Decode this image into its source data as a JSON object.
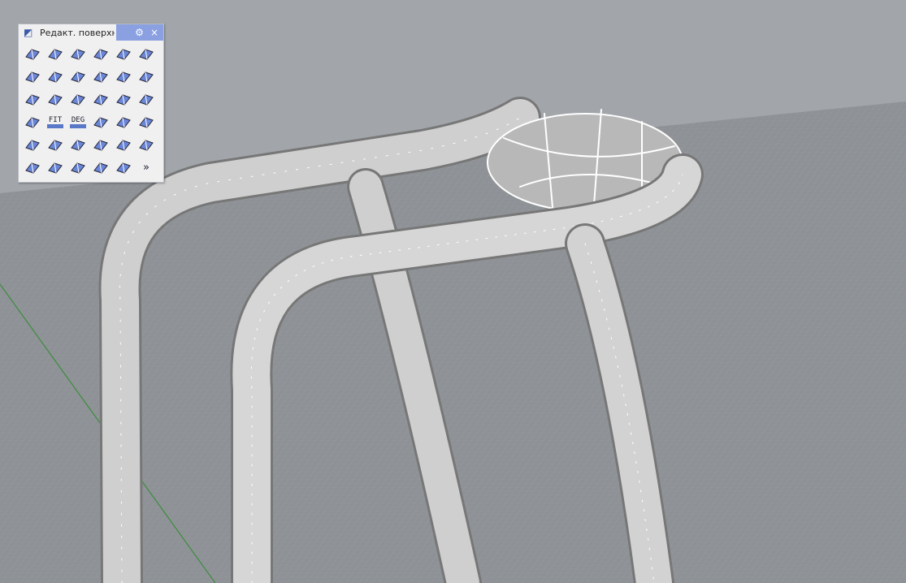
{
  "toolbar": {
    "title": "Редакт. поверхн",
    "settings_icon": "gear-icon",
    "close_label": "×",
    "overflow_label": "»",
    "buttons": [
      {
        "icon": "blend-surface-icon"
      },
      {
        "icon": "connect-surface-icon"
      },
      {
        "icon": "extend-surface-icon"
      },
      {
        "icon": "fillet-surface-icon"
      },
      {
        "icon": "chamfer-surface-icon"
      },
      {
        "icon": "match-surface-icon"
      },
      {
        "icon": "variable-fillet-icon"
      },
      {
        "icon": "offset-surface-icon"
      },
      {
        "icon": "transform-cage-icon"
      },
      {
        "icon": "bend-surface-icon"
      },
      {
        "icon": "merge-surface-icon"
      },
      {
        "icon": "split-surface-icon"
      },
      {
        "icon": "symmetry-surface-icon"
      },
      {
        "icon": "set-pt-icon"
      },
      {
        "icon": "extrude-surface-icon"
      },
      {
        "icon": "arch-icon"
      },
      {
        "icon": "wave-surface-icon"
      },
      {
        "icon": "person-table-icon"
      },
      {
        "icon": "person-box-icon"
      },
      {
        "label": "FIT",
        "icon": "fit-icon"
      },
      {
        "label": "DEG",
        "icon": "degree-icon"
      },
      {
        "icon": "knife-cut-icon"
      },
      {
        "icon": "person-push-icon"
      },
      {
        "icon": "point-on-target-icon"
      },
      {
        "icon": "shrink-trimmed-icon"
      },
      {
        "icon": "control-points-circle-icon"
      },
      {
        "icon": "solid-control-points-icon"
      },
      {
        "icon": "cylinder-icon"
      },
      {
        "icon": "triangle-points-icon"
      },
      {
        "icon": "pen-surface-icon"
      },
      {
        "icon": "bug-icon"
      },
      {
        "icon": "surface-edit-icon"
      },
      {
        "icon": "unroll-icon"
      },
      {
        "icon": "remove-knot-icon"
      },
      {
        "icon": "zebra-analysis-icon"
      }
    ]
  },
  "colors": {
    "sky": "#a2a6aa",
    "ground": "#8e9296",
    "grid": "#999da1",
    "axis_green": "#3c8c3c",
    "surface": "#c8c8c8",
    "isocurve": "#ffffff",
    "panel_accent": "#8aa0e0"
  }
}
